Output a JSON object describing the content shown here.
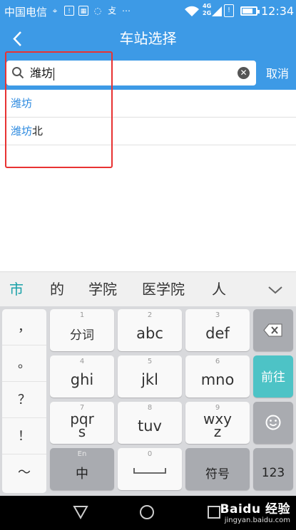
{
  "status_bar": {
    "carrier": "中国电信",
    "network": "4G",
    "network2": "2G",
    "time": "12:34",
    "battery_level": 0.8
  },
  "header": {
    "title": "车站选择",
    "back_icon": "chevron-left-icon"
  },
  "search": {
    "value": "潍坊",
    "cancel_label": "取消",
    "search_icon": "search-icon",
    "clear_icon": "clear-icon"
  },
  "results": [
    {
      "match": "潍坊",
      "rest": ""
    },
    {
      "match": "潍坊",
      "rest": "北"
    }
  ],
  "candidates": [
    "市",
    "的",
    "学院",
    "医学院",
    "人"
  ],
  "keyboard": {
    "punctuation": [
      "，",
      "。",
      "？",
      "！",
      "～"
    ],
    "rows": [
      [
        {
          "num": "1",
          "label": "分词"
        },
        {
          "num": "2",
          "label": "abc"
        },
        {
          "num": "3",
          "label": "def"
        }
      ],
      [
        {
          "num": "4",
          "label": "ghi"
        },
        {
          "num": "5",
          "label": "jkl"
        },
        {
          "num": "6",
          "label": "mno"
        }
      ],
      [
        {
          "num": "7",
          "label": "pqr\ns"
        },
        {
          "num": "8",
          "label": "tuv"
        },
        {
          "num": "9",
          "label": "wxy\nz"
        }
      ]
    ],
    "bottom": {
      "lang_hint": "En",
      "lang_label": "中",
      "space_num": "0",
      "symbol_label": "符号",
      "number_label": "123"
    },
    "go_label": "前往",
    "backspace_icon": "backspace-icon",
    "emoji_icon": "emoji-icon"
  },
  "watermark": {
    "brand": "Baidu 经验",
    "url": "jingyan.baidu.com"
  },
  "colors": {
    "primary": "#3d9ae6",
    "highlight": "#2f8be0",
    "accent": "#4dc3c6",
    "annotation": "#e83232"
  }
}
